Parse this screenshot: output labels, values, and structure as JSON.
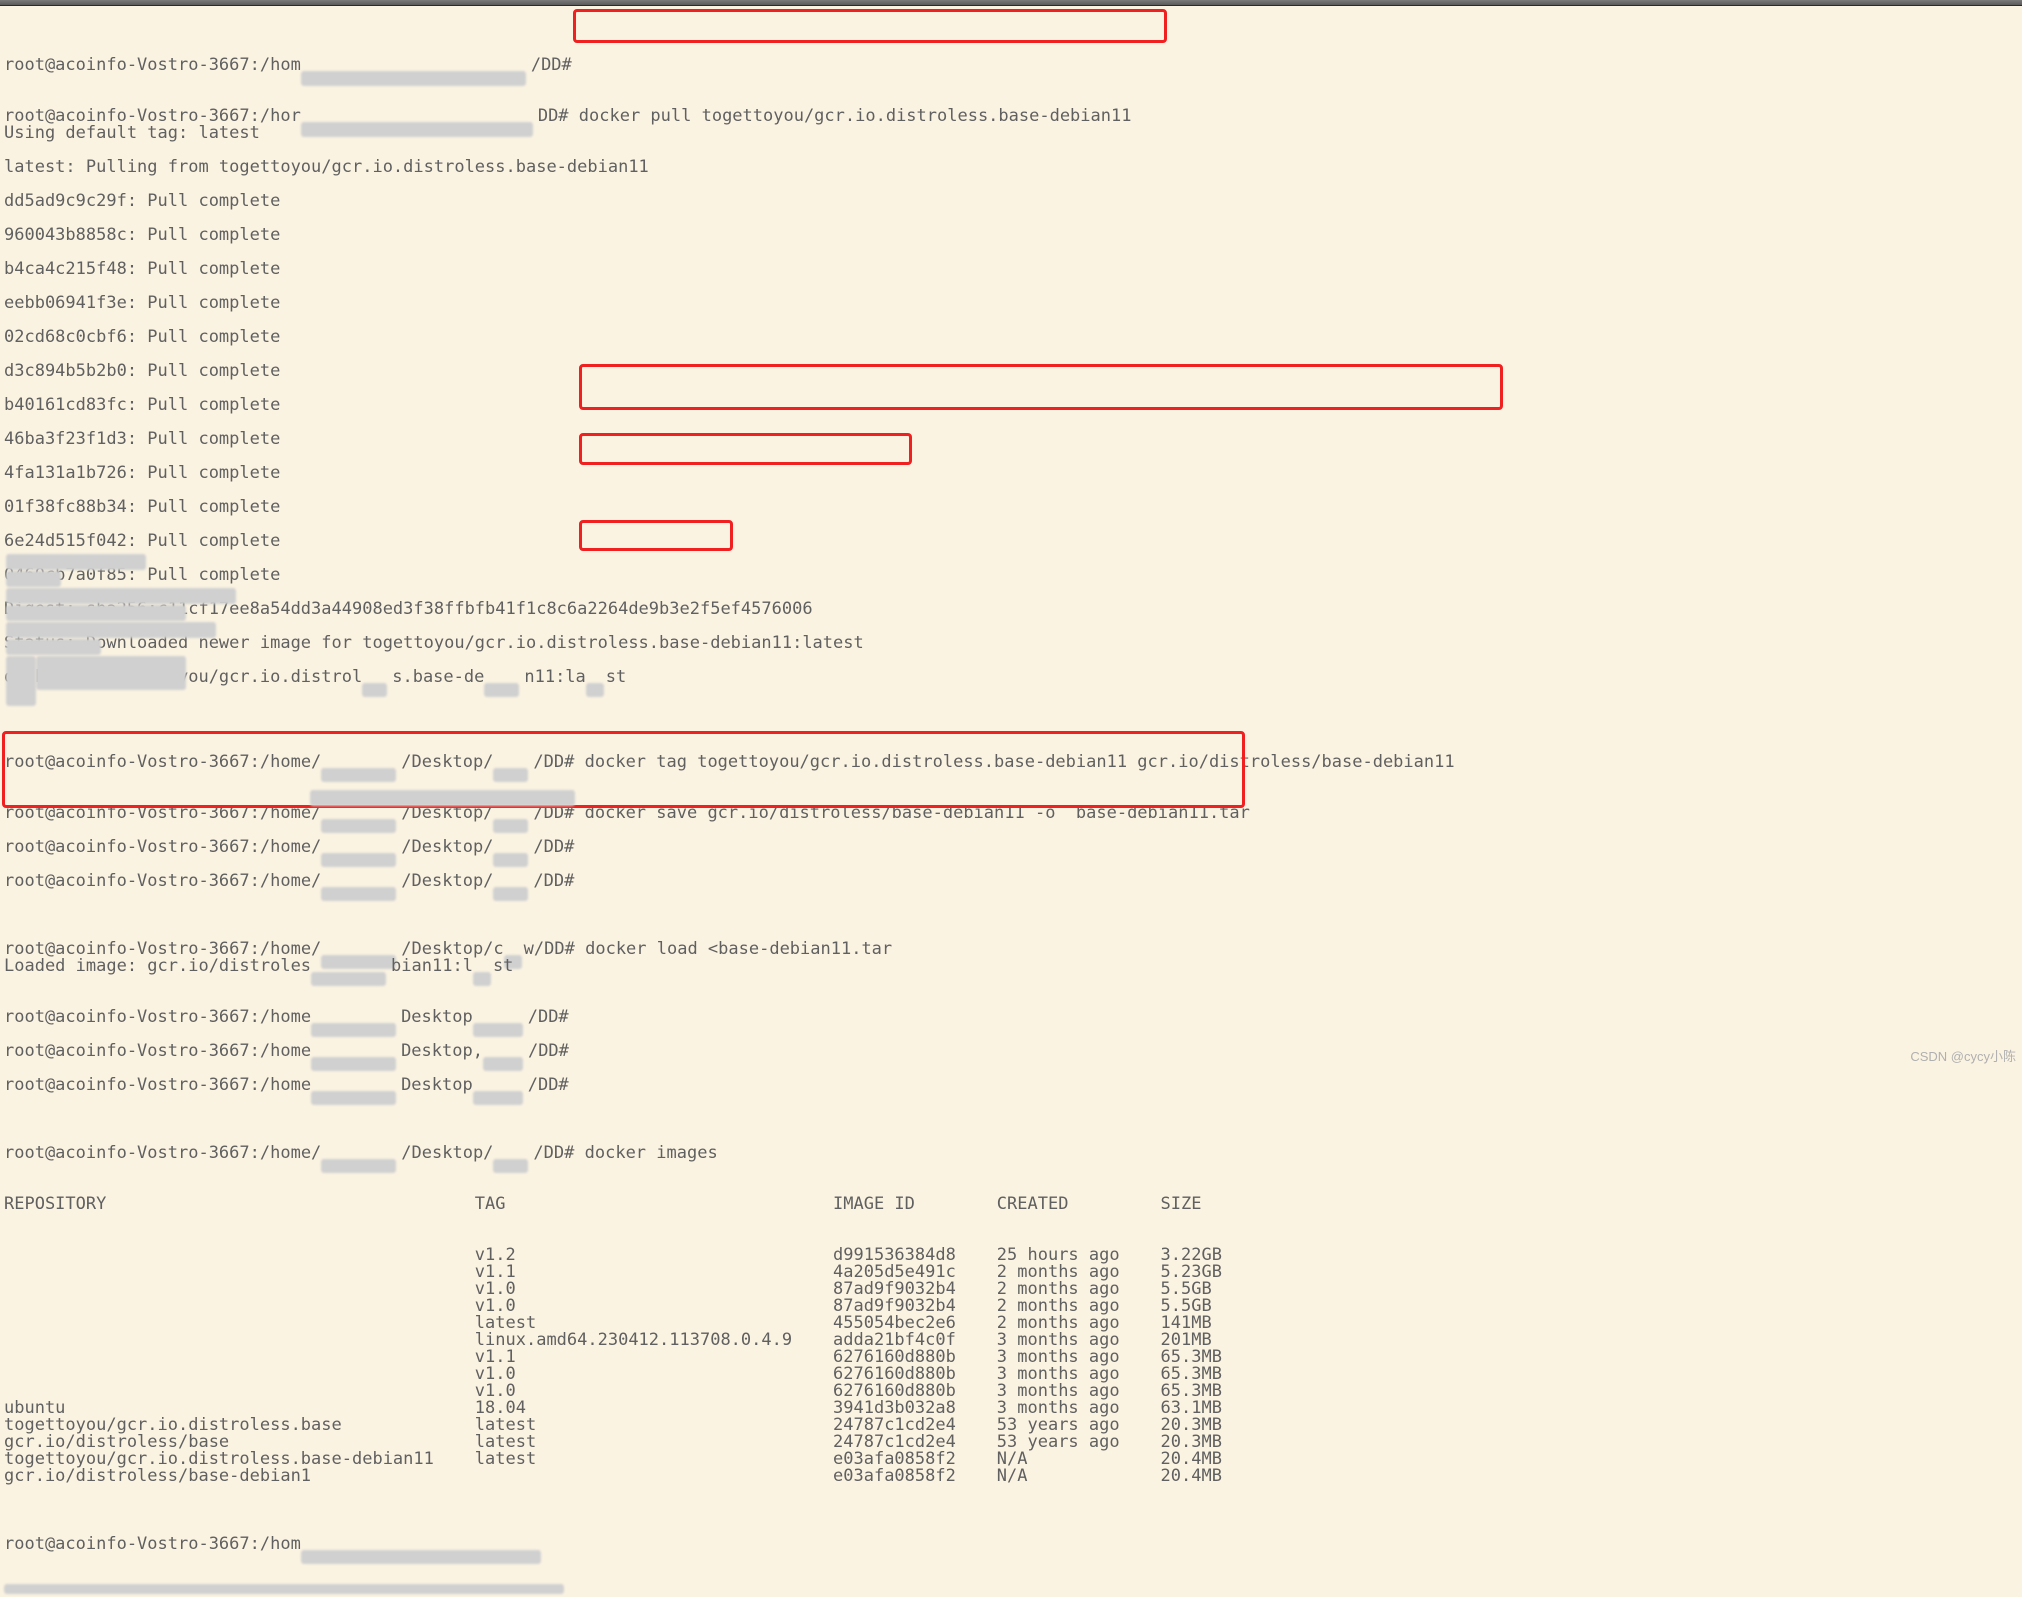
{
  "prompt_host": "root@acoinfo-Vostro-3667:",
  "prompt_path_home": "/hom",
  "prompt_path_home_full": "/home/",
  "prompt_path_home_short": "/home",
  "prompt_suffix_dd": "/DD#",
  "prompt_desktop": "/Desktop/",
  "cmd_pull": " docker pull togettoyou/gcr.io.distroless.base-debian11",
  "pull_default": "Using default tag: latest",
  "pull_from": "latest: Pulling from togettoyou/gcr.io.distroless.base-debian11",
  "layers": [
    "dd5ad9c9c29f: Pull complete",
    "960043b8858c: Pull complete",
    "b4ca4c215f48: Pull complete",
    "eebb06941f3e: Pull complete",
    "02cd68c0cbf6: Pull complete",
    "d3c894b5b2b0: Pull complete",
    "b40161cd83fc: Pull complete",
    "46ba3f23f1d3: Pull complete",
    "4fa131a1b726: Pull complete",
    "01f38fc88b34: Pull complete",
    "6e24d515f042: Pull complete",
    "0460cb7a0f85: Pull complete"
  ],
  "digest": "Digest: sha256:c11cf17ee8a54dd3a44908ed3f38ffbfb41f1c8c6a2264de9b3e2f5ef4576006",
  "status": "Status: Downloaded newer image for togettoyou/gcr.io.distroless.base-debian11:latest",
  "dockerio": "docker.io/togettoyou/gcr.io.distrol",
  "dockerio_tail": "s.base-de",
  "dockerio_end": "n11:la",
  "dockerio_end2": "st",
  "cmd_tag": "docker tag togettoyou/gcr.io.distroless.base-debian11 gcr.io/distroless/base-debian11",
  "cmd_save": "docker save gcr.io/distroless/base-debian11 -o  base-debian11.tar",
  "cmd_load": "docker load <base-debian11.tar",
  "loaded_pre": "Loaded image: gcr.io/distroles",
  "loaded_mid": "bian11:l",
  "loaded_end": "st",
  "cmd_images": "docker images",
  "hdr": {
    "repo": "REPOSITORY",
    "tag": "TAG",
    "id": "IMAGE ID",
    "created": "CREATED",
    "size": "SIZE"
  },
  "rows": [
    {
      "repo": "",
      "tag": "v1.2",
      "id": "d991536384d8",
      "created": "25 hours ago",
      "size": "3.22GB"
    },
    {
      "repo": "",
      "tag": "v1.1",
      "id": "4a205d5e491c",
      "created": "2 months ago",
      "size": "5.23GB"
    },
    {
      "repo": "",
      "tag": "v1.0",
      "id": "87ad9f9032b4",
      "created": "2 months ago",
      "size": "5.5GB"
    },
    {
      "repo": "",
      "tag": "v1.0",
      "id": "87ad9f9032b4",
      "created": "2 months ago",
      "size": "5.5GB"
    },
    {
      "repo": "",
      "tag": "latest",
      "id": "455054bec2e6",
      "created": "2 months ago",
      "size": "141MB"
    },
    {
      "repo": "",
      "tag": "linux.amd64.230412.113708.0.4.9",
      "id": "adda21bf4c0f",
      "created": "3 months ago",
      "size": "201MB"
    },
    {
      "repo": "",
      "tag": "v1.1",
      "id": "6276160d880b",
      "created": "3 months ago",
      "size": "65.3MB"
    },
    {
      "repo": "",
      "tag": "v1.0",
      "id": "6276160d880b",
      "created": "3 months ago",
      "size": "65.3MB"
    },
    {
      "repo": "",
      "tag": "v1.0",
      "id": "6276160d880b",
      "created": "3 months ago",
      "size": "65.3MB"
    },
    {
      "repo": "ubuntu",
      "tag": "18.04",
      "id": "3941d3b032a8",
      "created": "3 months ago",
      "size": "63.1MB"
    },
    {
      "repo": "togettoyou/gcr.io.distroless.base",
      "tag": "latest",
      "id": "24787c1cd2e4",
      "created": "53 years ago",
      "size": "20.3MB"
    },
    {
      "repo": "gcr.io/distroless/base",
      "tag": "latest",
      "id": "24787c1cd2e4",
      "created": "53 years ago",
      "size": "20.3MB"
    },
    {
      "repo": "togettoyou/gcr.io.distroless.base-debian11",
      "tag": "latest",
      "id": "e03afa0858f2",
      "created": "N/A",
      "size": "20.4MB"
    },
    {
      "repo": "gcr.io/distroless/base-debian1",
      "tag": "",
      "id": "e03afa0858f2",
      "created": "N/A",
      "size": "20.4MB"
    }
  ],
  "watermark": "CSDN @cycy小陈"
}
